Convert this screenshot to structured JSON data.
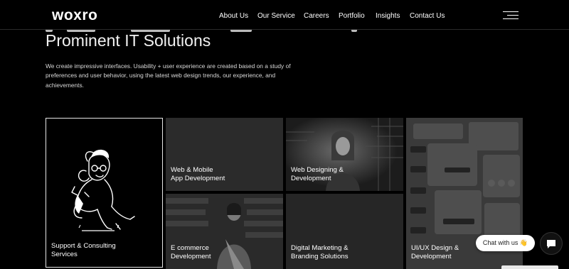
{
  "brand": {
    "logo_text": "woxro"
  },
  "nav": {
    "items": [
      "About Us",
      "Our Service",
      "Careers",
      "Portfolio",
      "Insights",
      "Contact Us"
    ],
    "menu_icon": "hamburger-icon"
  },
  "hero": {
    "title": "Prominent IT Solutions",
    "description": "We create impressive interfaces. Usability + user experience are created based on a study of preferences and user behavior, using the latest web design trends, our experience, and achievements."
  },
  "services": [
    {
      "label": "Support & Consulting\nServices"
    },
    {
      "label": "Web & Mobile\nApp Development"
    },
    {
      "label": "Web Designing &\nDevelopment"
    },
    {
      "label": "UI/UX Design &\nDevelopment"
    },
    {
      "label": "E commerce\nDevelopment"
    },
    {
      "label": "Digital Marketing &\nBranding Solutions"
    }
  ],
  "chat": {
    "prompt": "Chat with us 👋",
    "icon": "chat-bubble-icon"
  },
  "colors": {
    "background": "#000000",
    "text": "#ffffff",
    "tile_border": "#e6e6e6"
  }
}
